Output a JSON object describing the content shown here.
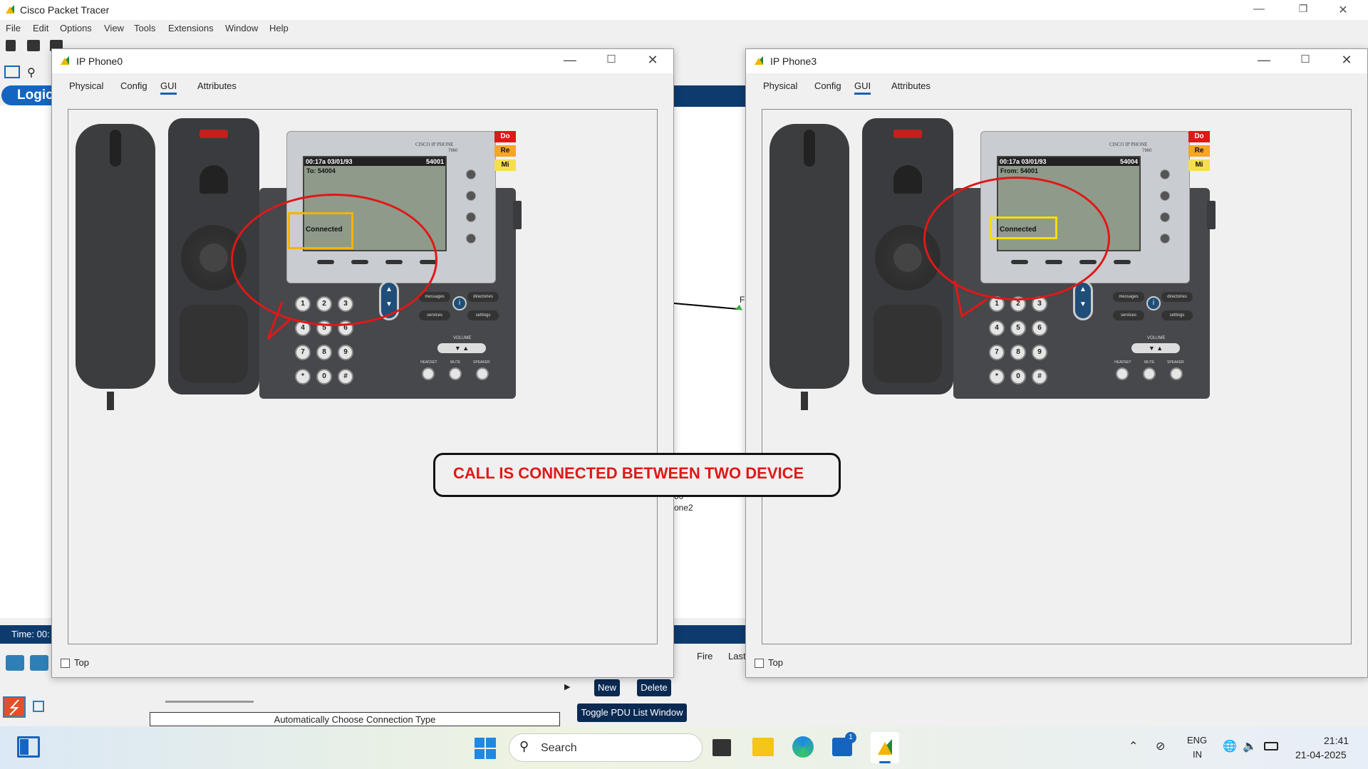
{
  "app": {
    "title": "Cisco Packet Tracer",
    "menu": [
      "File",
      "Edit",
      "Options",
      "View",
      "Tools",
      "Extensions",
      "Window",
      "Help"
    ],
    "logical_tab": "Logic",
    "time_label": "Time: 00:",
    "workspace_labels": {
      "port": "F",
      "device_a": "00",
      "device_b": "one2"
    },
    "bottom": {
      "new_label": "New",
      "delete_label": "Delete",
      "toggle_label": "Toggle PDU List Window",
      "fire_col": "Fire",
      "last_col": "Last",
      "conn_type": "Automatically Choose Connection Type"
    }
  },
  "dialogs": [
    {
      "title": "IP Phone0",
      "tabs": [
        "Physical",
        "Config",
        "GUI",
        "Attributes"
      ],
      "active_tab": "GUI",
      "top_label": "Top",
      "phone": {
        "brand": "CISCO IP PHONE",
        "model": "7960",
        "header_time": "00:17a 03/01/93",
        "header_ext": "54001",
        "line2": "To: 54004",
        "status": "Connected",
        "side_labels": [
          "Do",
          "Re",
          "Mi"
        ]
      }
    },
    {
      "title": "IP Phone3",
      "tabs": [
        "Physical",
        "Config",
        "GUI",
        "Attributes"
      ],
      "active_tab": "GUI",
      "top_label": "Top",
      "phone": {
        "brand": "CISCO IP PHONE",
        "model": "7960",
        "header_time": "00:17a 03/01/93",
        "header_ext": "54004",
        "line2": "From: 54001",
        "status": "Connected",
        "side_labels": [
          "Do",
          "Re",
          "Mi"
        ]
      }
    }
  ],
  "keypad": [
    "1",
    "2",
    "3",
    "4",
    "5",
    "6",
    "7",
    "8",
    "9",
    "*",
    "0",
    "#"
  ],
  "phone_buttons": {
    "messages": "messages",
    "directories": "directories",
    "services": "services",
    "settings": "settings",
    "volume": "VOLUME",
    "headset": "HEADSET",
    "mute": "MUTE",
    "speaker": "SPEAKER"
  },
  "annotation": "CALL IS CONNECTED BETWEEN TWO DEVICE",
  "taskbar": {
    "search_placeholder": "Search",
    "lang_top": "ENG",
    "lang_bottom": "IN",
    "time": "21:41",
    "date": "21-04-2025",
    "store_badge": "1"
  },
  "colors": {
    "accent": "#1565c0",
    "annotation_red": "#e01818",
    "highlight_yellow": "#f5b301"
  }
}
